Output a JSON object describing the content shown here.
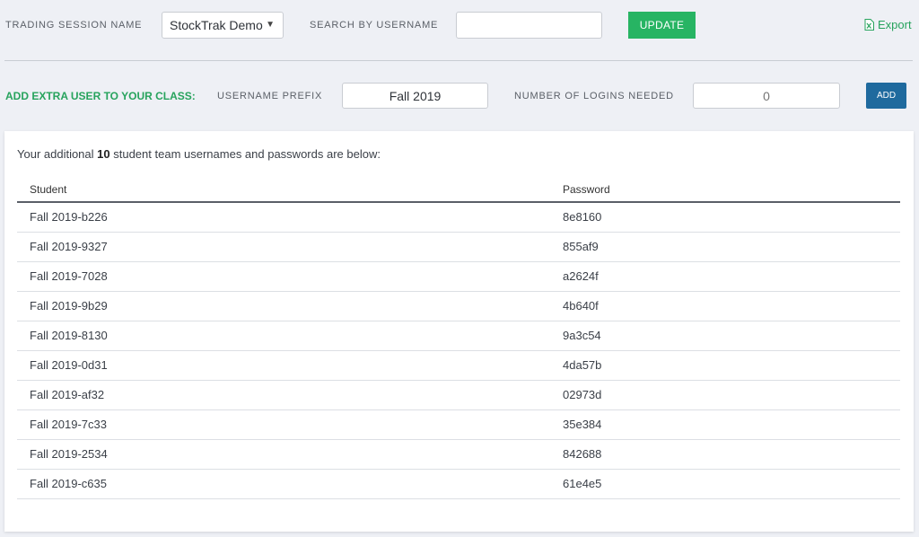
{
  "filters": {
    "session_label": "TRADING SESSION NAME",
    "session_value": "StockTrak Demo Class",
    "search_label": "SEARCH BY USERNAME",
    "search_value": "",
    "update_label": "UPDATE",
    "export_label": "Export"
  },
  "add_user": {
    "title": "ADD EXTRA USER TO YOUR CLASS:",
    "prefix_label": "USERNAME PREFIX",
    "prefix_value": "Fall 2019",
    "logins_label": "NUMBER OF LOGINS NEEDED",
    "logins_placeholder": "0",
    "add_label": "ADD"
  },
  "results": {
    "intro_before": "Your additional ",
    "count": "10",
    "intro_after": " student team usernames and passwords are below:",
    "columns": {
      "student": "Student",
      "password": "Password"
    },
    "rows": [
      {
        "student": "Fall 2019-b226",
        "password": "8e8160"
      },
      {
        "student": "Fall 2019-9327",
        "password": "855af9"
      },
      {
        "student": "Fall 2019-7028",
        "password": "a2624f"
      },
      {
        "student": "Fall 2019-9b29",
        "password": "4b640f"
      },
      {
        "student": "Fall 2019-8130",
        "password": "9a3c54"
      },
      {
        "student": "Fall 2019-0d31",
        "password": "4da57b"
      },
      {
        "student": "Fall 2019-af32",
        "password": "02973d"
      },
      {
        "student": "Fall 2019-7c33",
        "password": "35e384"
      },
      {
        "student": "Fall 2019-2534",
        "password": "842688"
      },
      {
        "student": "Fall 2019-c635",
        "password": "61e4e5"
      }
    ]
  },
  "colors": {
    "accent_green": "#27b463",
    "button_blue": "#1f6a9e",
    "background": "#eef0f5"
  }
}
